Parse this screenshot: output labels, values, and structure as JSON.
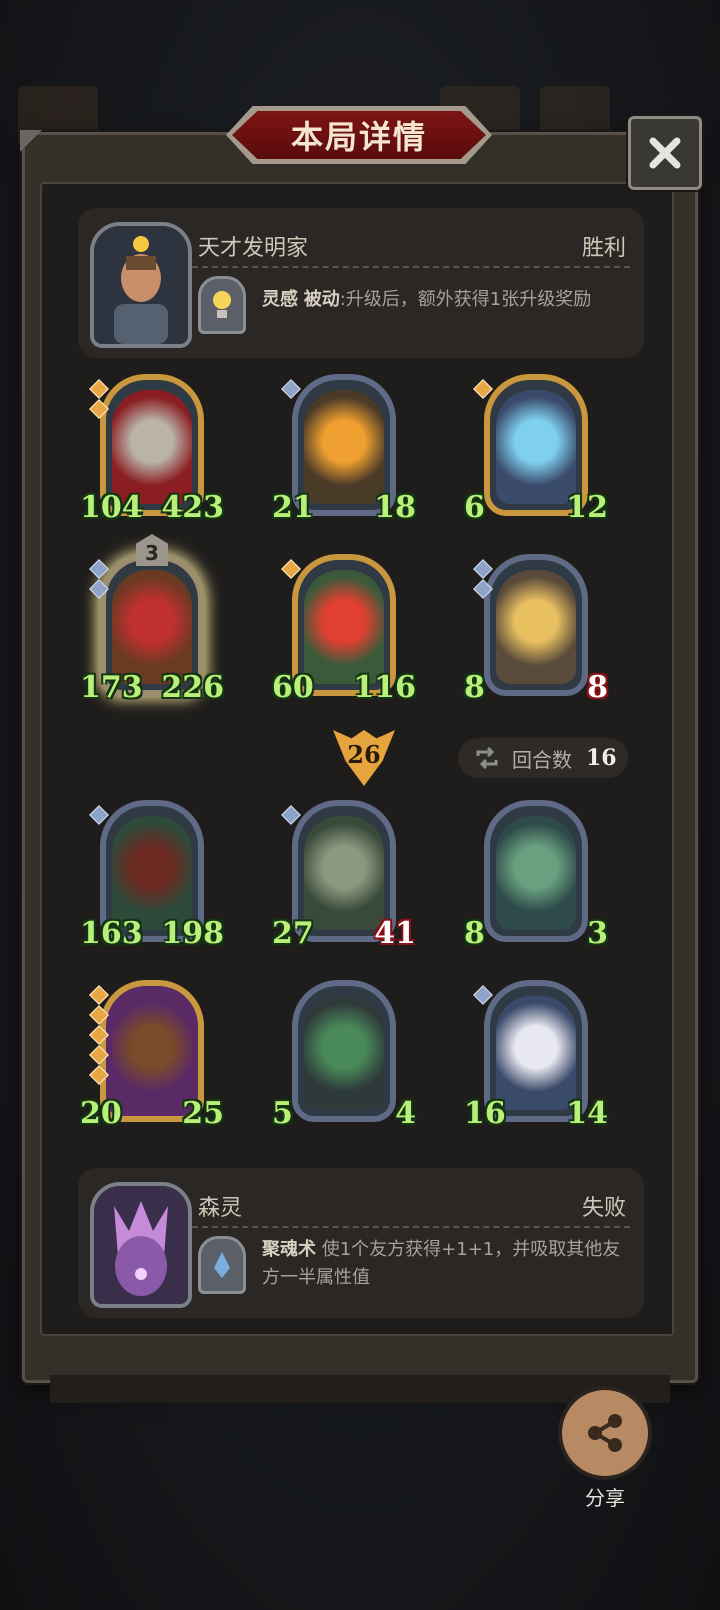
{
  "title": "本局详情",
  "top_player": {
    "name": "天才发明家",
    "result": "胜利",
    "skill_name": "灵感",
    "skill_tag": "被动",
    "skill_desc": ":升级后，额外获得1张升级奖励"
  },
  "cards_top": [
    {
      "atk": "104",
      "hp": "423",
      "style": "gold",
      "gems": [
        "gold",
        "gold"
      ],
      "art": "armored-knight"
    },
    {
      "atk": "21",
      "hp": "18",
      "style": "blue",
      "gems": [
        "blue"
      ],
      "art": "tree-monster"
    },
    {
      "atk": "6",
      "hp": "12",
      "style": "gold",
      "gems": [
        "gold"
      ],
      "art": "sea-witch"
    },
    {
      "atk": "173",
      "hp": "226",
      "style": "blue",
      "gems": [
        "blue",
        "blue"
      ],
      "art": "ogre",
      "level": "3"
    },
    {
      "atk": "60",
      "hp": "116",
      "style": "gold",
      "gems": [
        "gold"
      ],
      "art": "red-imp"
    },
    {
      "atk": "8",
      "hp": "8",
      "style": "blue",
      "gems": [
        "blue",
        "blue"
      ],
      "art": "pinocchio",
      "hp_danger": true
    }
  ],
  "kill_count": "26",
  "rounds": {
    "label": "回合数",
    "value": "16"
  },
  "cards_bottom": [
    {
      "atk": "163",
      "hp": "198",
      "style": "blue",
      "gems": [
        "blue"
      ],
      "art": "boar"
    },
    {
      "atk": "27",
      "hp": "41",
      "style": "blue",
      "gems": [
        "blue"
      ],
      "art": "stone-golem",
      "hp_danger": true
    },
    {
      "atk": "8",
      "hp": "3",
      "style": "blue",
      "gems": [],
      "art": "parrot"
    },
    {
      "atk": "20",
      "hp": "25",
      "style": "purple",
      "gems": [
        "gold",
        "gold",
        "gold",
        "gold",
        "gold"
      ],
      "art": "tiki-mask"
    },
    {
      "atk": "5",
      "hp": "4",
      "style": "blue",
      "gems": [],
      "art": "plant-monster"
    },
    {
      "atk": "16",
      "hp": "14",
      "style": "blue",
      "gems": [
        "blue"
      ],
      "art": "fox-dog"
    }
  ],
  "bottom_player": {
    "name": "森灵",
    "result": "失败",
    "skill_name": "聚魂术",
    "skill_desc": " 使1个友方获得+1+1，并吸取其他友方一半属性值"
  },
  "share_label": "分享",
  "colors": {
    "accent": "#7d1414",
    "stat_green": "#b9f07a",
    "atk_blue": "#3d6291",
    "hp_red": "#9a2530"
  }
}
